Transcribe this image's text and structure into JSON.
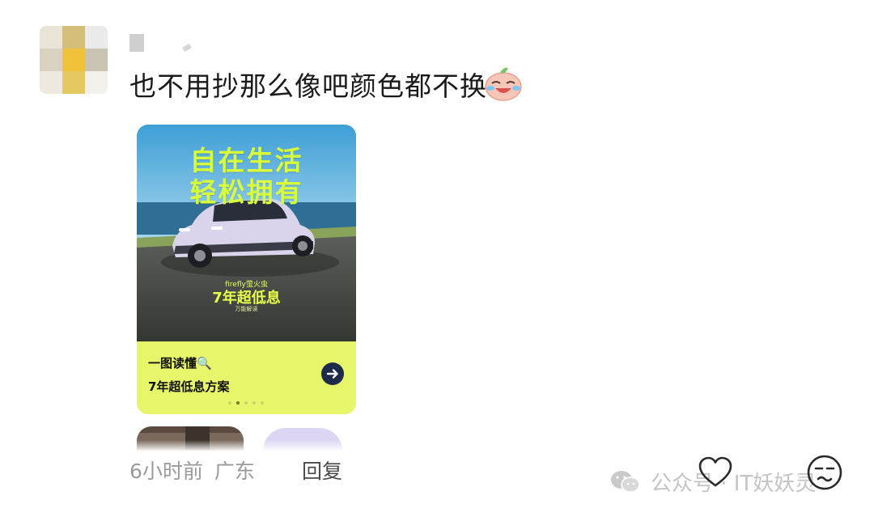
{
  "comment": {
    "text": "也不用抄那么像吧颜色都不换",
    "time": "6小时前",
    "location": "广东",
    "reply_label": "回复"
  },
  "ad_card": {
    "headline_1": "自在生活",
    "headline_2": "轻松拥有",
    "brand": "firefly萤火虫",
    "promo": "7年超低息",
    "promo_sub": "万能解读",
    "line1": "一图读懂",
    "line2": "7年超低息方案",
    "magnifier_glyph": "🔍",
    "accent_color": "#e7f56a",
    "headline_color": "#d9ff3a",
    "carousel_pages": 5,
    "carousel_active_index": 1
  },
  "watermark": {
    "text": "公众号 · IT妖妖灵"
  },
  "icons": {
    "avatar": "blurred-avatar",
    "emoji": "crying-laughing-emoji",
    "arrow": "arrow-right-icon",
    "like": "heart-outline-icon",
    "dislike": "unamused-face-icon",
    "wechat": "wechat-icon"
  }
}
